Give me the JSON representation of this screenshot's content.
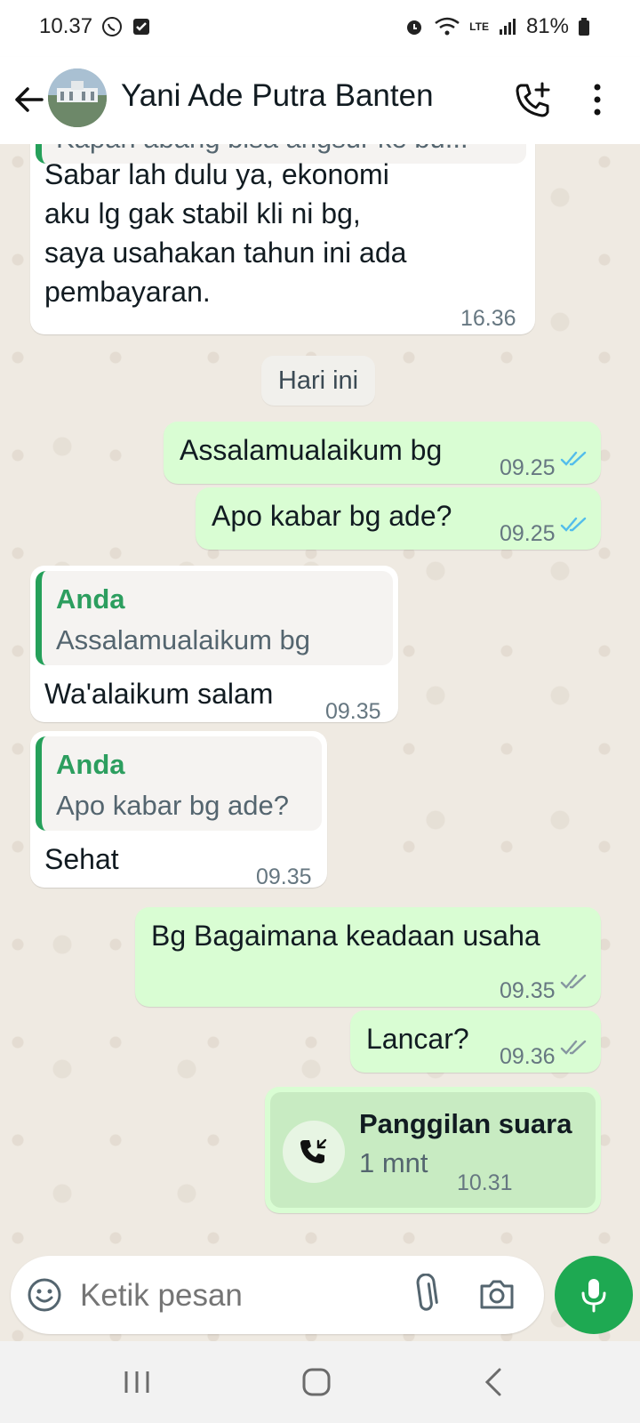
{
  "status_bar": {
    "time": "10.37",
    "battery": "81%",
    "network": "LTE"
  },
  "header": {
    "contact_name": "Yani Ade Putra Banten"
  },
  "messages": [
    {
      "partial_quote": "Kapan abang bisa angsur ke bu...",
      "text_lines": [
        "Sabar lah dulu ya, ekonomi",
        "aku lg gak stabil kli ni bg,",
        "saya usahakan tahun ini ada",
        "pembayaran."
      ],
      "time": "16.36"
    },
    {
      "day_label": "Hari ini"
    },
    {
      "text": "Assalamualaikum bg",
      "time": "09.25",
      "status": "read"
    },
    {
      "text": "Apo kabar bg ade?",
      "time": "09.25",
      "status": "read"
    },
    {
      "quote_author": "Anda",
      "quote_text": "Assalamualaikum bg",
      "text": "Wa'alaikum salam",
      "time": "09.35"
    },
    {
      "quote_author": "Anda",
      "quote_text": "Apo kabar bg ade?",
      "text": "Sehat",
      "time": "09.35"
    },
    {
      "text": "Bg Bagaimana keadaan usaha",
      "time": "09.35",
      "status": "delivered"
    },
    {
      "text": "Lancar?",
      "time": "09.36",
      "status": "delivered"
    },
    {
      "call_title": "Panggilan suara",
      "call_duration": "1 mnt",
      "time": "10.31"
    }
  ],
  "composer": {
    "placeholder": "Ketik pesan"
  },
  "colors": {
    "accent": "#1ea952",
    "outgoing": "#d9fdd3",
    "incoming": "#ffffff",
    "read_ticks": "#53bdeb",
    "quote_author": "#2c9e5f"
  }
}
